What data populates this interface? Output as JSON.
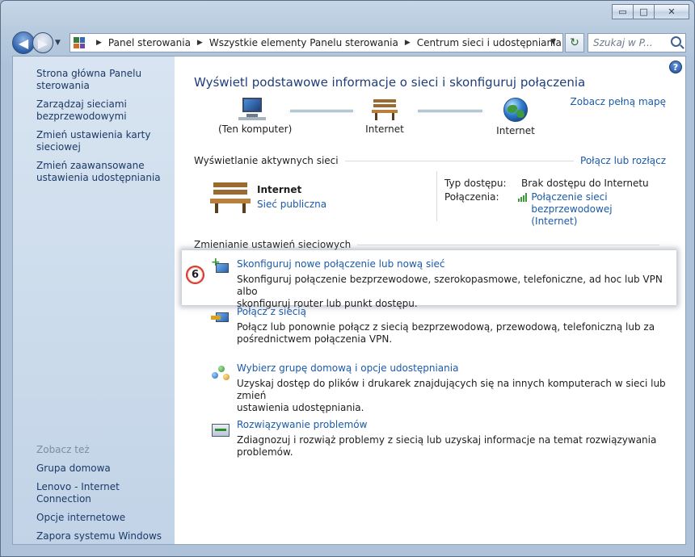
{
  "window": {
    "caption": {
      "minimize": "▭",
      "maximize": "□",
      "close": "✕"
    }
  },
  "nav": {
    "breadcrumbs": [
      "Panel sterowania",
      "Wszystkie elementy Panelu sterowania",
      "Centrum sieci i udostępniania"
    ],
    "search_placeholder": "Szukaj w P..."
  },
  "sidebar": {
    "items": [
      {
        "label": "Strona główna Panelu sterowania"
      },
      {
        "label": "Zarządzaj sieciami bezprzewodowymi"
      },
      {
        "label": "Zmień ustawienia karty sieciowej"
      },
      {
        "label": "Zmień zaawansowane ustawienia udostępniania"
      }
    ],
    "see_also_title": "Zobacz też",
    "see_also": [
      {
        "label": "Grupa domowa"
      },
      {
        "label": "Lenovo - Internet Connection"
      },
      {
        "label": "Opcje internetowe"
      },
      {
        "label": "Zapora systemu Windows"
      }
    ]
  },
  "main": {
    "title": "Wyświetl podstawowe informacje o sieci i skonfiguruj połączenia",
    "full_map_link": "Zobacz pełną mapę",
    "diagram": {
      "nodes": [
        {
          "label": "(Ten komputer)",
          "icon": "computer-icon"
        },
        {
          "label": "Internet",
          "icon": "bench-icon"
        },
        {
          "label": "Internet",
          "icon": "globe-icon"
        }
      ]
    },
    "active_networks": {
      "heading": "Wyświetlanie aktywnych sieci",
      "connect_link": "Połącz lub rozłącz",
      "network_name": "Internet",
      "network_type": "Sieć publiczna",
      "access_type_label": "Typ dostępu:",
      "access_type_value": "Brak dostępu do Internetu",
      "connections_label": "Połączenia:",
      "connections_value_line1": "Połączenie sieci bezprzewodowej",
      "connections_value_line2": "(Internet)"
    },
    "change_settings": {
      "heading": "Zmienianie ustawień sieciowych",
      "callout_number": "6",
      "tasks": [
        {
          "title": "Skonfiguruj nowe połączenie lub nową sieć",
          "desc_line1": "Skonfiguruj połączenie bezprzewodowe, szerokopasmowe, telefoniczne, ad hoc lub VPN albo",
          "desc_line2": "skonfiguruj router lub punkt dostępu."
        },
        {
          "title": "Połącz z siecią",
          "desc_line1": "Połącz lub ponownie połącz z siecią bezprzewodową, przewodową, telefoniczną lub za",
          "desc_line2": "pośrednictwem połączenia VPN."
        },
        {
          "title": "Wybierz grupę domową i opcje udostępniania",
          "desc_line1": "Uzyskaj dostęp do plików i drukarek znajdujących się na innych komputerach w sieci lub zmień",
          "desc_line2": "ustawienia udostępniania."
        },
        {
          "title": "Rozwiązywanie problemów",
          "desc_line1": "Zdiagnozuj i rozwiąż problemy z siecią lub uzyskaj informacje na temat rozwiązywania problemów.",
          "desc_line2": ""
        }
      ]
    }
  }
}
